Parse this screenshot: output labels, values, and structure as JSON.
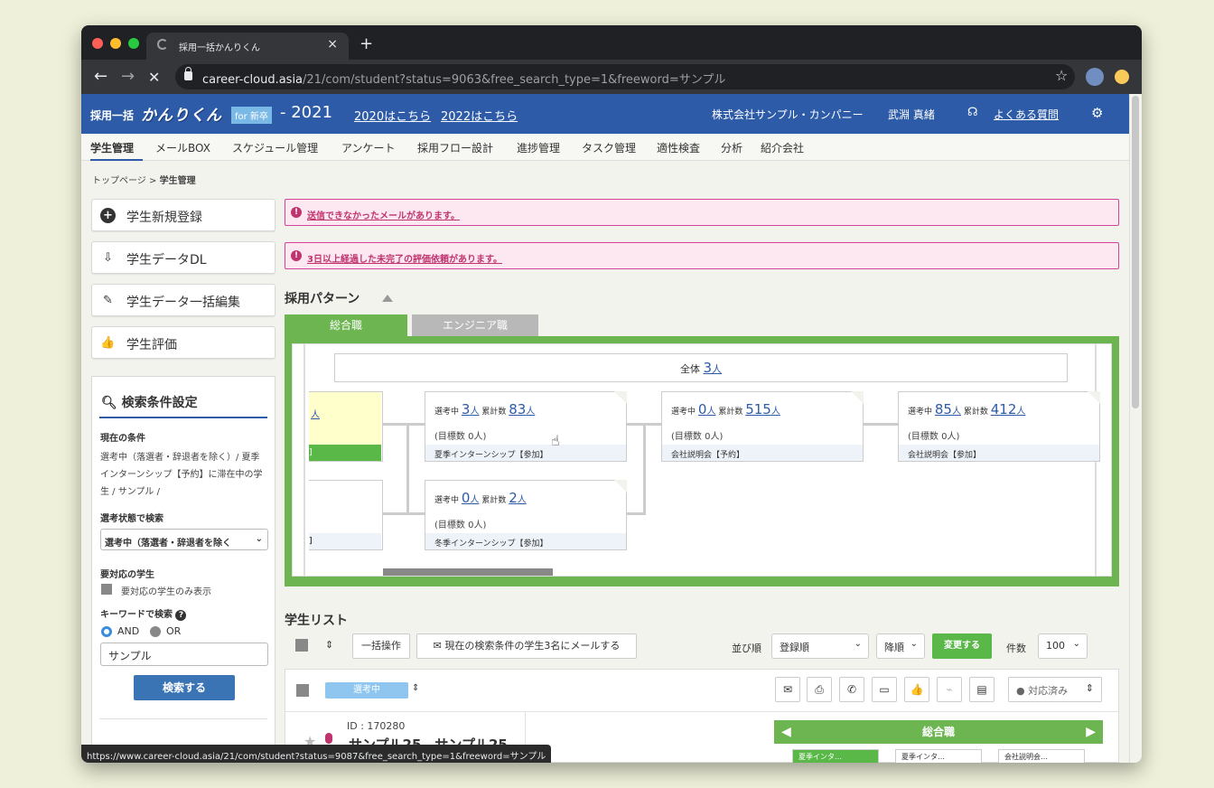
{
  "browser": {
    "tab_title": "採用一括かんりくん",
    "tab_close": "×",
    "new_tab": "+",
    "url_host": "career-cloud.asia",
    "url_path": "/21/com/student?status=9063&free_search_type=1&freeword=サンプル",
    "back": "←",
    "forward": "→",
    "stop": "✕",
    "bookmark_star": "☆",
    "status_url": "https://www.career-cloud.asia/21/com/student?status=9087&free_search_type=1&freeword=サンプル"
  },
  "header": {
    "logo_small": "採用一括",
    "logo_main": "かんりくん",
    "logo_badge": "for 新卒",
    "year": "- 2021",
    "link_2020": "2020はこちら",
    "link_2022": "2022はこちら",
    "company": "株式会社サンプル・カンパニー",
    "user": "武淵 真緒",
    "faq": "よくある質問"
  },
  "menu": [
    "学生管理",
    "メールBOX",
    "スケジュール管理",
    "アンケート",
    "採用フロー設計",
    "進捗管理",
    "タスク管理",
    "適性検査",
    "分析",
    "紹介会社"
  ],
  "breadcrumb": {
    "home": "トップページ",
    "sep": ">",
    "current": "学生管理"
  },
  "sidebar": {
    "buttons": [
      {
        "label": "学生新規登録",
        "icon": "plus-circle-icon"
      },
      {
        "label": "学生データDL",
        "icon": "download-icon"
      },
      {
        "label": "学生データ一括編集",
        "icon": "edit-icon"
      },
      {
        "label": "学生評価",
        "icon": "thumbs-up-icon"
      }
    ],
    "search": {
      "title": "検索条件設定",
      "current_label": "現在の条件",
      "current_text": "選考中（落選者・辞退者を除く）/ 夏季インターンシップ【予約】に滞在中の学生 / サンプル /",
      "status_label": "選考状態で検索",
      "status_value": "選考中（落選者・辞退者を除く",
      "attention_label": "要対応の学生",
      "attention_check": "要対応の学生のみ表示",
      "keyword_label": "キーワードで検索",
      "and_label": "AND",
      "or_label": "OR",
      "keyword_value": "サンプル",
      "search_button": "検索する"
    }
  },
  "alerts": [
    "送信できなかったメールがあります。",
    "3日以上経過した未完了の評価依頼があります。"
  ],
  "pattern": {
    "title": "採用パターン",
    "tabs": [
      "総合職",
      "エンジニア職"
    ],
    "active_tab": "総合職",
    "total_label": "全体",
    "total_count": "3",
    "total_unit": "人",
    "partial_card": {
      "unit": "人",
      "bracket": "]"
    },
    "partial_card_2": {
      "bracket": "]"
    },
    "cards": [
      {
        "selecting_label": "選考中",
        "selecting": "3",
        "unit": "人",
        "cumulative_label": "累計数",
        "cumulative": "83",
        "target": "(目標数 0人)",
        "stage": "夏季インターンシップ【参加】"
      },
      {
        "selecting_label": "選考中",
        "selecting": "0",
        "unit": "人",
        "cumulative_label": "累計数",
        "cumulative": "515",
        "target": "(目標数 0人)",
        "stage": "会社説明会【予約】"
      },
      {
        "selecting_label": "選考中",
        "selecting": "85",
        "unit": "人",
        "cumulative_label": "累計数",
        "cumulative": "412",
        "target": "(目標数 0人)",
        "stage": "会社説明会【参加】"
      },
      {
        "selecting_label": "選考中",
        "selecting": "0",
        "unit": "人",
        "cumulative_label": "累計数",
        "cumulative": "2",
        "target": "(目標数 0人)",
        "stage": "冬季インターンシップ【参加】"
      }
    ]
  },
  "student_list": {
    "title": "学生リスト",
    "bulk_button": "一括操作",
    "mail_button": "現在の検索条件の学生3名にメールする",
    "sort_label": "並び順",
    "sort_value": "登録順",
    "order_value": "降順",
    "apply_button": "変更する",
    "count_label": "件数",
    "count_value": "100",
    "status_pill": "選考中",
    "response_select": "● 対応済み",
    "student_id": "ID : 170280",
    "student_name": "サンプル25　サンプル25",
    "mini_flow_title": "総合職",
    "mini_chips": [
      "夏季インタ…",
      "夏季インタ…",
      "会社説明会…"
    ]
  },
  "colors": {
    "header_blue": "#2d5ba8",
    "flow_green": "#6cb550",
    "alert_pink": "#c0336f",
    "button_blue": "#3a74b5"
  }
}
